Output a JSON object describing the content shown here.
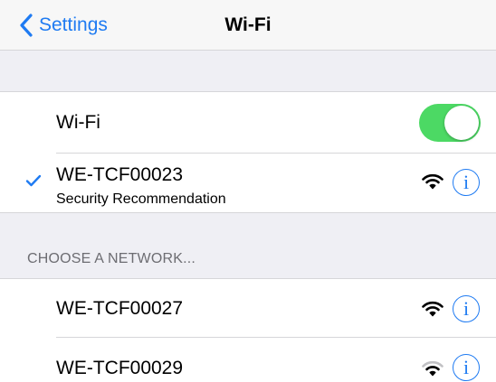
{
  "navbar": {
    "back_label": "Settings",
    "title": "Wi-Fi"
  },
  "wifi_toggle": {
    "label": "Wi-Fi",
    "on": true,
    "color": "#4cd964"
  },
  "connected_network": {
    "name": "WE-TCF00023",
    "subtitle": "Security Recommendation",
    "info_icon": "i"
  },
  "section": {
    "header": "CHOOSE A NETWORK..."
  },
  "networks": [
    {
      "name": "WE-TCF00027",
      "info_icon": "i"
    },
    {
      "name": "WE-TCF00029",
      "info_icon": "i"
    }
  ],
  "colors": {
    "accent": "#1f7bf2",
    "toggle_on": "#4cd964",
    "group_background": "#efeff4",
    "separator": "#d6d6d9"
  }
}
